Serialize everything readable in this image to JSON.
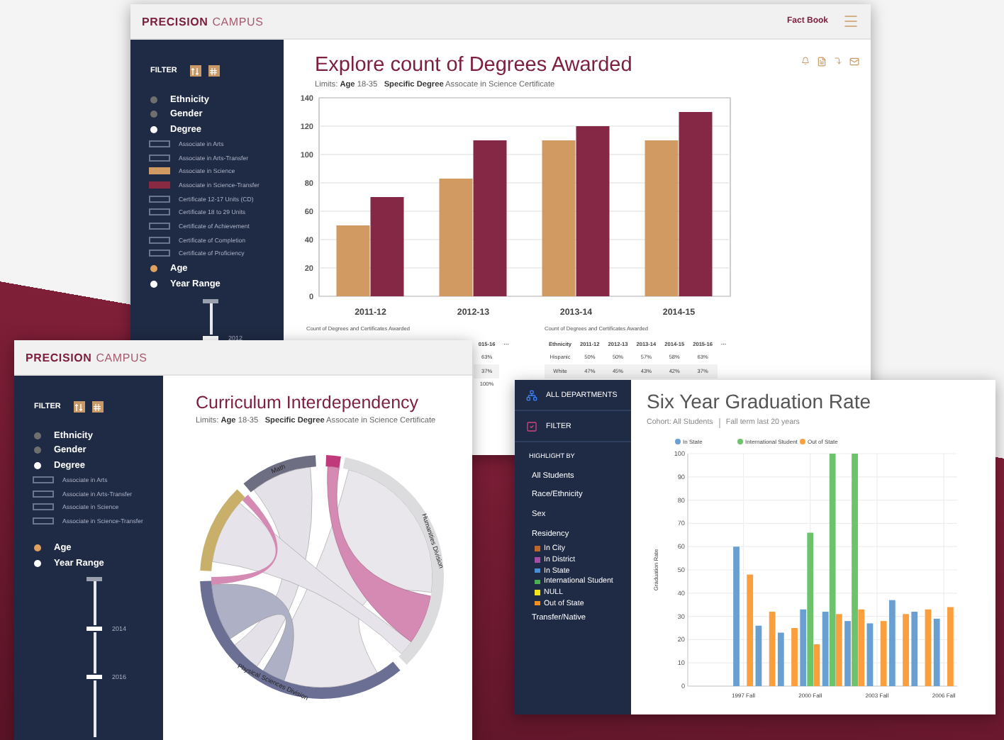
{
  "top_window": {
    "brand": "PRECISION",
    "brand_suffix": "CAMPUS",
    "nav_link": "Fact Book",
    "sidebar": {
      "filter_label": "FILTER",
      "items": [
        {
          "kind": "group",
          "label": "Ethnicity",
          "color": "#6f6f6f"
        },
        {
          "kind": "group",
          "label": "Gender",
          "color": "#6f6f6f"
        },
        {
          "kind": "group",
          "label": "Degree",
          "color": "#ffffff"
        },
        {
          "kind": "degree",
          "label": "Associate in Arts"
        },
        {
          "kind": "degree",
          "label": "Associate in Arts-Transfer"
        },
        {
          "kind": "degree",
          "label": "Associate in Science",
          "color": "#d09a62"
        },
        {
          "kind": "degree",
          "label": "Associate in Science-Transfer",
          "color": "#8a2942"
        },
        {
          "kind": "degree",
          "label": "Certificate 12-17 Units (CD)"
        },
        {
          "kind": "degree",
          "label": "Certificate 18 to 29 Units"
        },
        {
          "kind": "degree",
          "label": "Certificate of Achievement"
        },
        {
          "kind": "degree",
          "label": "Certificate of Completion"
        },
        {
          "kind": "degree",
          "label": "Certificate of Proficiency"
        },
        {
          "kind": "group",
          "label": "Age",
          "color": "#e0a060"
        },
        {
          "kind": "group",
          "label": "Year Range",
          "color": "#ffffff"
        }
      ],
      "year_range": {
        "labels": [
          "2012"
        ]
      }
    },
    "title": "Explore count of Degrees Awarded",
    "limits": "Limits: **Age** 18-35   **Specific Degree** Assocate in Science Certificate",
    "chart_data": {
      "type": "bar",
      "grid": true,
      "categories": [
        "2011-12",
        "2012-13",
        "2013-14",
        "2014-15"
      ],
      "ylim": [
        0,
        140
      ],
      "yticks": [
        0,
        20,
        40,
        60,
        80,
        100,
        120,
        140
      ],
      "series": [
        {
          "color": "#d09a62",
          "values": [
            50,
            83,
            110,
            110
          ]
        },
        {
          "color": "#842846",
          "values": [
            70,
            110,
            120,
            130
          ]
        }
      ]
    },
    "tables": [
      {
        "title": "Count of Degrees and Certificates Awarded",
        "columns": [
          "015-16",
          "···"
        ],
        "rows": [
          [
            "63%"
          ],
          [
            "37%"
          ],
          [
            "100%"
          ]
        ]
      },
      {
        "title": "Count of Degrees and Certificates Awarded",
        "columns": [
          "Ethnicity",
          "2011-12",
          "2012-13",
          "2013-14",
          "2014-15",
          "2015-16",
          "···"
        ],
        "rows": [
          [
            "Hispanic",
            "50%",
            "50%",
            "57%",
            "58%",
            "63%"
          ],
          [
            "White",
            "47%",
            "45%",
            "43%",
            "42%",
            "37%"
          ]
        ]
      }
    ]
  },
  "left_window": {
    "brand": "PRECISION",
    "brand_suffix": "CAMPUS",
    "sidebar": {
      "filter_label": "FILTER",
      "items": [
        {
          "kind": "group",
          "label": "Ethnicity",
          "color": "#6f6f6f"
        },
        {
          "kind": "group",
          "label": "Gender",
          "color": "#6f6f6f"
        },
        {
          "kind": "group",
          "label": "Degree",
          "color": "#ffffff"
        },
        {
          "kind": "degree",
          "label": "Associate in Arts"
        },
        {
          "kind": "degree",
          "label": "Associate in Arts-Transfer"
        },
        {
          "kind": "degree",
          "label": "Associate in Science"
        },
        {
          "kind": "degree",
          "label": "Associate in Science-Transfer"
        },
        {
          "kind": "group",
          "label": "Age",
          "color": "#e0a060"
        },
        {
          "kind": "group",
          "label": "Year Range",
          "color": "#ffffff"
        }
      ],
      "year_range": {
        "labels": [
          "2014",
          "2016"
        ]
      }
    },
    "title": "Curriculum Interdependency",
    "limits": "Limits: **Age** 18-35   **Specific Degree** Assocate in Science Certificate",
    "arc_labels": [
      "Math",
      "Humanities Division",
      "Physical Sciences Division"
    ]
  },
  "right_window": {
    "sidebar": {
      "nav": [
        {
          "kind": "departments",
          "label": "ALL DEPARTMENTS"
        },
        {
          "kind": "filter",
          "label": "FILTER"
        }
      ],
      "section_label": "HIGHLIGHT BY",
      "options": [
        {
          "label": "All Students"
        },
        {
          "label": "Race/Ethnicity"
        },
        {
          "label": "Sex"
        },
        {
          "label": "Residency",
          "children": [
            {
              "label": "In City",
              "color": "#c0662a"
            },
            {
              "label": "In District",
              "color": "#a64ca6"
            },
            {
              "label": "In State",
              "color": "#4a8fd6"
            },
            {
              "label": "International Student",
              "color": "#4caf50"
            },
            {
              "label": "NULL",
              "color": "#f2e51e"
            },
            {
              "label": "Out of State",
              "color": "#f7901e"
            }
          ]
        },
        {
          "label": "Transfer/Native"
        }
      ]
    },
    "title": "Six Year Graduation Rate",
    "cohort": "Cohort: All Students",
    "term": "Fall term last 20 years",
    "chart_data": {
      "type": "bar",
      "grid": true,
      "legend": "top",
      "ylabel": "Graduation Rate",
      "xlim": [
        1994.5,
        2006.6
      ],
      "x": [
        1997,
        1998,
        1999,
        2000,
        2001,
        2002,
        2003,
        2004,
        2005,
        2006
      ],
      "xticks": [
        {
          "value": 1997,
          "label": "1997 Fall"
        },
        {
          "value": 2000,
          "label": "2000 Fall"
        },
        {
          "value": 2003,
          "label": "2003 Fall"
        },
        {
          "value": 2006,
          "label": "2006 Fall"
        }
      ],
      "ylim": [
        0,
        100
      ],
      "yticks": [
        0,
        10,
        20,
        30,
        40,
        50,
        60,
        70,
        80,
        90,
        100
      ],
      "series": [
        {
          "name": "In State",
          "color": "#6a9fd2",
          "values": [
            60,
            26,
            23,
            33,
            32,
            28,
            27,
            37,
            32,
            29
          ]
        },
        {
          "name": "International Student",
          "color": "#6cc36c",
          "values": [
            null,
            null,
            null,
            66,
            100,
            100,
            null,
            null,
            null,
            null
          ]
        },
        {
          "name": "Out of State",
          "color": "#fb9f3e",
          "values": [
            48,
            32,
            25,
            18,
            31,
            33,
            28,
            31,
            33,
            34
          ]
        }
      ]
    }
  }
}
